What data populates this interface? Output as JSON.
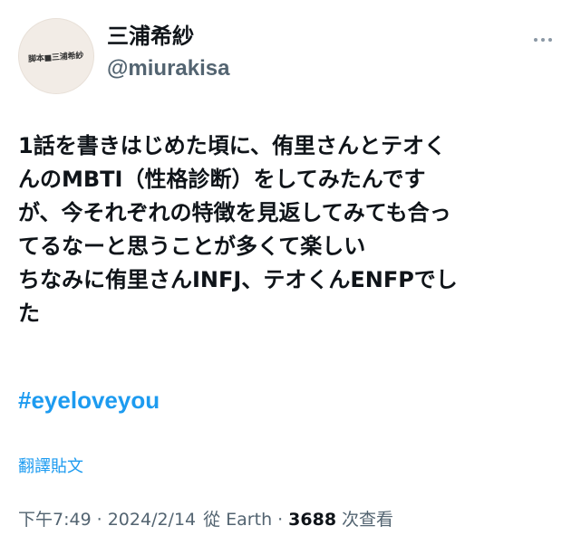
{
  "author": {
    "display_name": "三浦希紗",
    "handle": "@miurakisa",
    "avatar_text": "脚本■三浦希紗"
  },
  "tweet": {
    "lines": [
      "1話を書きはじめた頃に、侑里さんとテオく",
      "んのMBTI（性格診断）をしてみたんです",
      "が、今それぞれの特徴を見返してみても合っ",
      "てるなーと思うことが多くて楽しい",
      "ちなみに侑里さんINFJ、テオくんENFPでし",
      "た"
    ],
    "hashtag": "#eyeloveyou",
    "translate_label": "翻譯貼文"
  },
  "meta": {
    "time": "下午7:49",
    "date": "2024/2/14",
    "from_label": "從",
    "source": "Earth",
    "views_count": "3688",
    "views_label": "次查看",
    "separator": "·"
  },
  "icons": {
    "more": "more-horizontal-icon"
  },
  "colors": {
    "link": "#1d9bf0",
    "secondary_text": "#536471",
    "primary_text": "#0f1419"
  }
}
